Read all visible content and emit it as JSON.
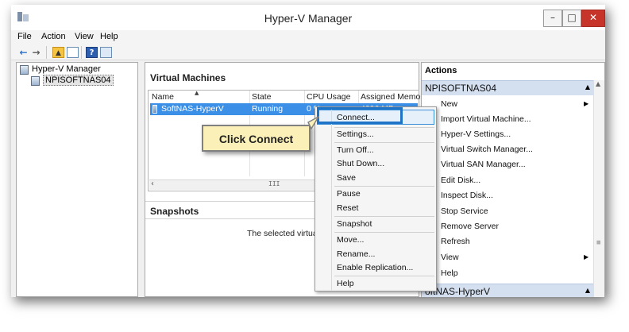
{
  "window": {
    "title": "Hyper-V Manager"
  },
  "menu": [
    "File",
    "Action",
    "View",
    "Help"
  ],
  "tree": {
    "root": "Hyper-V Manager",
    "server": "NPISOFTNAS04"
  },
  "vms": {
    "header": "Virtual Machines",
    "columns": [
      "Name",
      "State",
      "CPU Usage",
      "Assigned Memory"
    ],
    "rows": [
      {
        "name": "SoftNAS-HyperV",
        "state": "Running",
        "cpu": "0 %",
        "memory": "4096 MB"
      }
    ]
  },
  "snapshots": {
    "header": "Snapshots",
    "text": "The selected virtual ma"
  },
  "actions": {
    "title": "Actions",
    "section1": "NPISOFTNAS04",
    "items": [
      "New",
      "Import Virtual Machine...",
      "Hyper-V Settings...",
      "Virtual Switch Manager...",
      "Virtual SAN Manager...",
      "Edit Disk...",
      "Inspect Disk...",
      "Stop Service",
      "Remove Server",
      "Refresh",
      "View",
      "Help"
    ],
    "section2": "oftNAS-HyperV"
  },
  "context_menu": [
    "Connect...",
    "Settings...",
    "Turn Off...",
    "Shut Down...",
    "Save",
    "Pause",
    "Reset",
    "Snapshot",
    "Move...",
    "Rename...",
    "Enable Replication...",
    "Help"
  ],
  "callout": {
    "text": "Click Connect"
  },
  "colors": {
    "selection": "#3b8fe6",
    "callout_bg": "#fbf1b8",
    "highlight_border": "#1f73c6",
    "section_bg": "#d4dff0"
  }
}
